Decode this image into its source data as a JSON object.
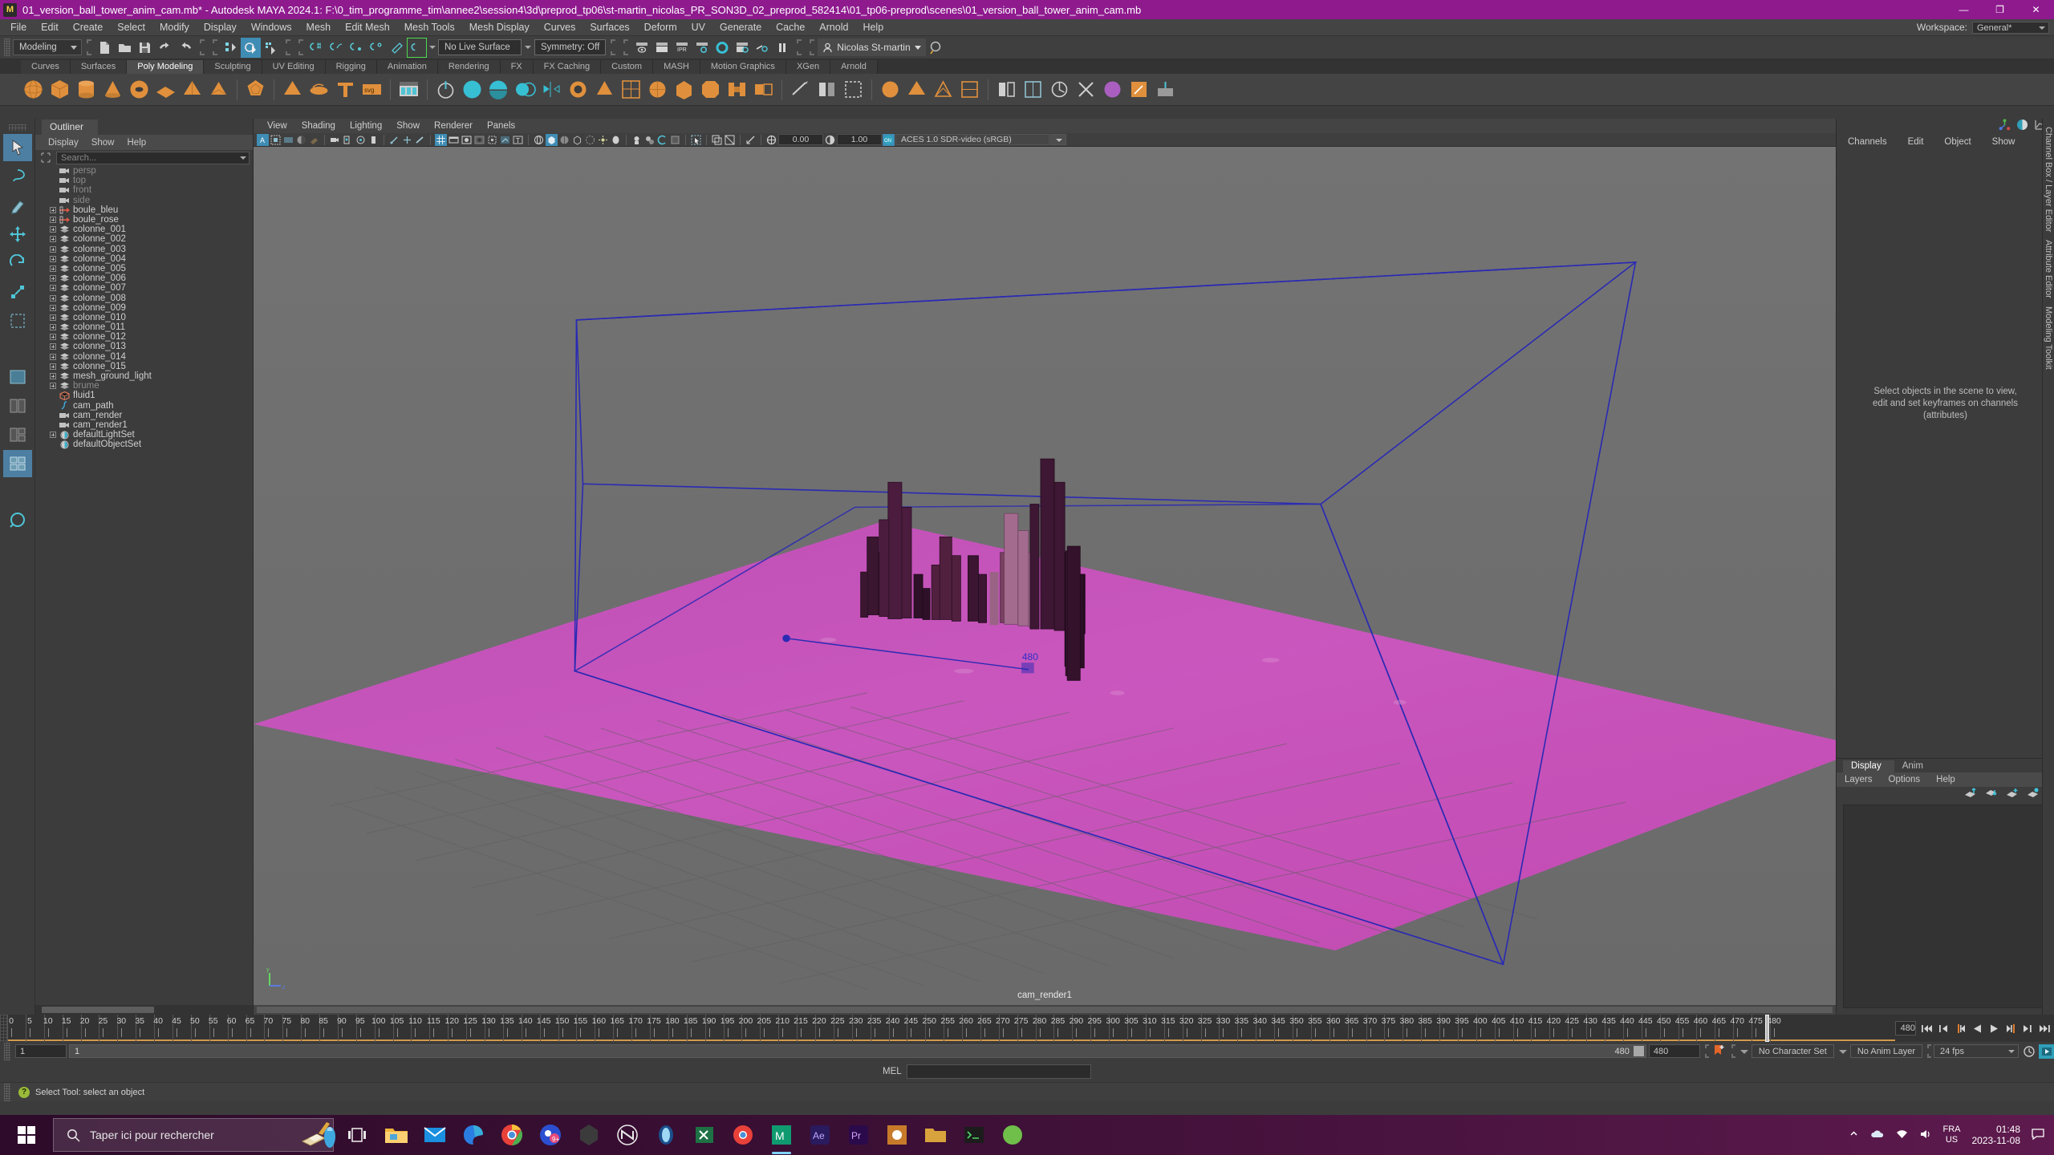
{
  "window": {
    "title": "01_version_ball_tower_anim_cam.mb* - Autodesk MAYA 2024.1: F:\\0_tim_programme_tim\\annee2\\session4\\3d\\preprod_tp06\\st-martin_nicolas_PR_SON3D_02_preprod_582414\\01_tp06-preprod\\scenes\\01_version_ball_tower_anim_cam.mb",
    "app_icon": "M",
    "minimize": "—",
    "maximize": "❐",
    "close": "✕"
  },
  "menubar": {
    "items": [
      "File",
      "Edit",
      "Create",
      "Select",
      "Modify",
      "Display",
      "Windows",
      "Mesh",
      "Edit Mesh",
      "Mesh Tools",
      "Mesh Display",
      "Curves",
      "Surfaces",
      "Deform",
      "UV",
      "Generate",
      "Cache",
      "Arnold",
      "Help"
    ],
    "workspace_label": "Workspace:",
    "workspace_value": "General*"
  },
  "statusline": {
    "menuset": "Modeling",
    "live_surface": "No Live Surface",
    "symmetry": "Symmetry: Off",
    "user": "Nicolas St-martin"
  },
  "shelf": {
    "tabs": [
      "Curves",
      "Surfaces",
      "Poly Modeling",
      "Sculpting",
      "UV Editing",
      "Rigging",
      "Animation",
      "Rendering",
      "FX",
      "FX Caching",
      "Custom",
      "MASH",
      "Motion Graphics",
      "XGen",
      "Arnold"
    ],
    "selected_tab": "Poly Modeling"
  },
  "outliner": {
    "tab_label": "Outliner",
    "menus": [
      "Display",
      "Show",
      "Help"
    ],
    "search_placeholder": "Search...",
    "items": [
      {
        "label": "persp",
        "icon": "camera-icon",
        "expandable": false,
        "dim": true
      },
      {
        "label": "top",
        "icon": "camera-icon",
        "expandable": false,
        "dim": true
      },
      {
        "label": "front",
        "icon": "camera-icon",
        "expandable": false,
        "dim": true
      },
      {
        "label": "side",
        "icon": "camera-icon",
        "expandable": false,
        "dim": true
      },
      {
        "label": "boule_bleu",
        "icon": "transform-icon",
        "expandable": true,
        "dim": false
      },
      {
        "label": "boule_rose",
        "icon": "transform-icon",
        "expandable": true,
        "dim": false
      },
      {
        "label": "colonne_001",
        "icon": "mesh-icon",
        "expandable": true,
        "dim": false
      },
      {
        "label": "colonne_002",
        "icon": "mesh-icon",
        "expandable": true,
        "dim": false
      },
      {
        "label": "colonne_003",
        "icon": "mesh-icon",
        "expandable": true,
        "dim": false
      },
      {
        "label": "colonne_004",
        "icon": "mesh-icon",
        "expandable": true,
        "dim": false
      },
      {
        "label": "colonne_005",
        "icon": "mesh-icon",
        "expandable": true,
        "dim": false
      },
      {
        "label": "colonne_006",
        "icon": "mesh-icon",
        "expandable": true,
        "dim": false
      },
      {
        "label": "colonne_007",
        "icon": "mesh-icon",
        "expandable": true,
        "dim": false
      },
      {
        "label": "colonne_008",
        "icon": "mesh-icon",
        "expandable": true,
        "dim": false
      },
      {
        "label": "colonne_009",
        "icon": "mesh-icon",
        "expandable": true,
        "dim": false
      },
      {
        "label": "colonne_010",
        "icon": "mesh-icon",
        "expandable": true,
        "dim": false
      },
      {
        "label": "colonne_011",
        "icon": "mesh-icon",
        "expandable": true,
        "dim": false
      },
      {
        "label": "colonne_012",
        "icon": "mesh-icon",
        "expandable": true,
        "dim": false
      },
      {
        "label": "colonne_013",
        "icon": "mesh-icon",
        "expandable": true,
        "dim": false
      },
      {
        "label": "colonne_014",
        "icon": "mesh-icon",
        "expandable": true,
        "dim": false
      },
      {
        "label": "colonne_015",
        "icon": "mesh-icon",
        "expandable": true,
        "dim": false
      },
      {
        "label": "mesh_ground_light",
        "icon": "mesh-icon",
        "expandable": true,
        "dim": false
      },
      {
        "label": "brume",
        "icon": "mesh-icon",
        "expandable": true,
        "dim": true
      },
      {
        "label": "fluid1",
        "icon": "fluid-icon",
        "expandable": false,
        "dim": false
      },
      {
        "label": "cam_path",
        "icon": "curve-icon",
        "expandable": false,
        "dim": false
      },
      {
        "label": "cam_render",
        "icon": "camera-icon",
        "expandable": false,
        "dim": false
      },
      {
        "label": "cam_render1",
        "icon": "camera-icon",
        "expandable": false,
        "dim": false
      },
      {
        "label": "defaultLightSet",
        "icon": "set-icon",
        "expandable": true,
        "dim": false
      },
      {
        "label": "defaultObjectSet",
        "icon": "set-icon",
        "expandable": false,
        "dim": false
      }
    ]
  },
  "viewport": {
    "menus": [
      "View",
      "Shading",
      "Lighting",
      "Show",
      "Renderer",
      "Panels"
    ],
    "exposure": "0.00",
    "gamma": "1.00",
    "color_management": "ACES 1.0 SDR-video (sRGB)",
    "camera_label": "cam_render1",
    "manipulator_value": "480"
  },
  "channelbox": {
    "menus": [
      "Channels",
      "Edit",
      "Object",
      "Show"
    ],
    "hint": "Select objects in the scene to view,\nedit and set keyframes on channels\n(attributes)",
    "side_tabs": [
      "Channel Box / Layer Editor",
      "Attribute Editor",
      "Modeling Toolkit"
    ]
  },
  "layers": {
    "tabs": [
      "Display",
      "Anim"
    ],
    "selected_tab": "Display",
    "menus": [
      "Layers",
      "Options",
      "Help"
    ]
  },
  "timeline": {
    "tick_labels": [
      0,
      5,
      10,
      15,
      20,
      25,
      30,
      35,
      40,
      45,
      50,
      55,
      60,
      65,
      70,
      75,
      80,
      85,
      90,
      95,
      100,
      105,
      110,
      115,
      120,
      125,
      130,
      135,
      140,
      145,
      150,
      155,
      160,
      165,
      170,
      175,
      180,
      185,
      190,
      195,
      200,
      205,
      210,
      215,
      220,
      225,
      230,
      235,
      240,
      245,
      250,
      255,
      260,
      265,
      270,
      275,
      280,
      285,
      290,
      295,
      300,
      305,
      310,
      315,
      320,
      325,
      330,
      335,
      340,
      345,
      350,
      355,
      360,
      365,
      370,
      375,
      380,
      385,
      390,
      395,
      400,
      405,
      410,
      415,
      420,
      425,
      430,
      435,
      440,
      445,
      450,
      455,
      460,
      465,
      470,
      475,
      480
    ],
    "current_frame": "480",
    "start": 0,
    "end": 480
  },
  "rangeslider": {
    "range_start": "1",
    "range_start_2": "1",
    "range_end": "480",
    "range_end_2": "480",
    "anim_end": "480",
    "character_set": "No Character Set",
    "anim_layer": "No Anim Layer",
    "fps": "24 fps"
  },
  "commandline": {
    "label": "MEL",
    "value": ""
  },
  "helpline": {
    "text": "Select Tool: select an object"
  },
  "taskbar": {
    "search_placeholder": "Taper ici pour rechercher",
    "lang_line1": "FRA",
    "lang_line2": "US",
    "time": "01:48",
    "date": "2023-11-08"
  },
  "colors": {
    "title_bar": "#8e1a8e",
    "accent": "#3f8db5",
    "shelf_orange": "#e0903c",
    "ground": "#c24fb8",
    "wire_blue": "#3030a8",
    "range_bar": "#d39a4e"
  }
}
